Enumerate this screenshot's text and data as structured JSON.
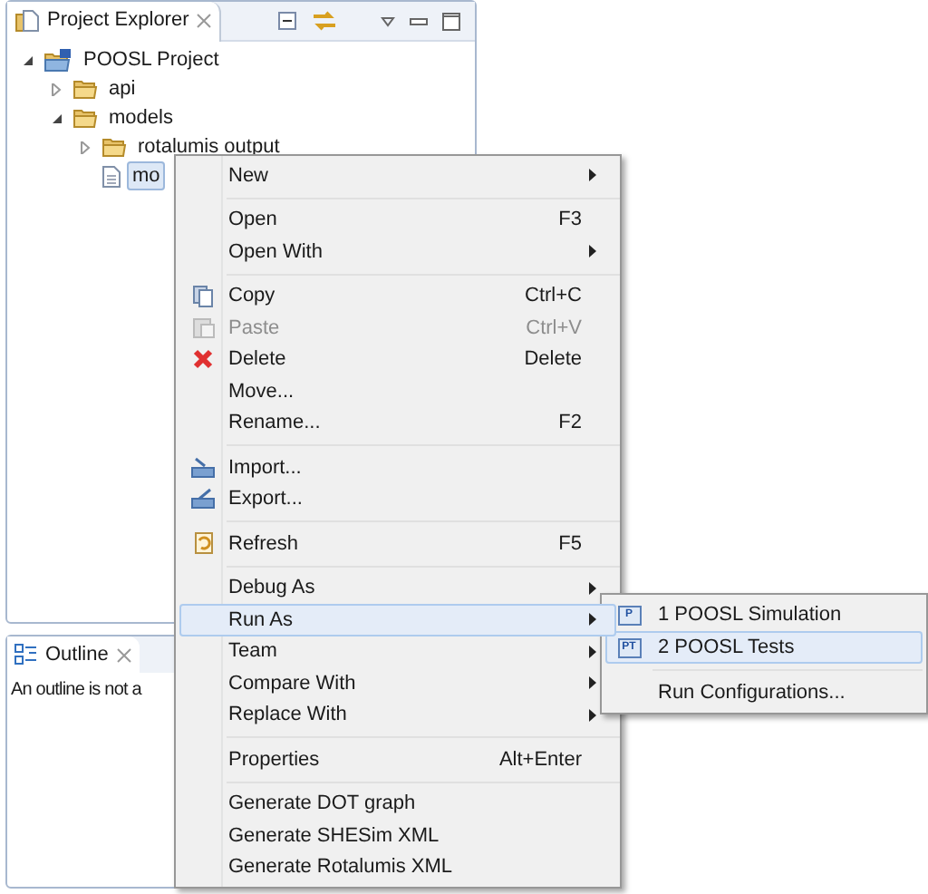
{
  "project_explorer": {
    "title": "Project Explorer",
    "tree": [
      {
        "label": "POOSL Project",
        "kind": "project",
        "expanded": true,
        "selected": false,
        "children": [
          {
            "label": "api",
            "kind": "folder",
            "expanded": false,
            "selected": false
          },
          {
            "label": "models",
            "kind": "folder",
            "expanded": true,
            "selected": false,
            "children": [
              {
                "label": "rotalumis output",
                "kind": "folder",
                "expanded": false,
                "selected": false
              },
              {
                "label": "mo",
                "kind": "file",
                "selected": true
              }
            ]
          }
        ]
      }
    ]
  },
  "outline": {
    "title": "Outline",
    "message": "An outline is not a"
  },
  "context_menu": {
    "items": [
      {
        "kind": "plain",
        "label": "New",
        "submenu": true,
        "selected": false,
        "disabled": false
      },
      {
        "kind": "separator"
      },
      {
        "kind": "plain",
        "label": "Open",
        "shortcut": "F3",
        "selected": false,
        "disabled": false
      },
      {
        "kind": "plain",
        "label": "Open With",
        "submenu": true,
        "selected": false,
        "disabled": false
      },
      {
        "kind": "separator"
      },
      {
        "kind": "copy",
        "label": "Copy",
        "shortcut": "Ctrl+C",
        "selected": false,
        "disabled": false
      },
      {
        "kind": "paste",
        "label": "Paste",
        "shortcut": "Ctrl+V",
        "selected": false,
        "disabled": true
      },
      {
        "kind": "delete",
        "label": "Delete",
        "shortcut": "Delete",
        "selected": false,
        "disabled": false
      },
      {
        "kind": "plain",
        "label": "Move...",
        "selected": false,
        "disabled": false
      },
      {
        "kind": "plain",
        "label": "Rename...",
        "shortcut": "F2",
        "selected": false,
        "disabled": false
      },
      {
        "kind": "separator"
      },
      {
        "kind": "import",
        "label": "Import...",
        "selected": false,
        "disabled": false
      },
      {
        "kind": "export",
        "label": "Export...",
        "selected": false,
        "disabled": false
      },
      {
        "kind": "separator"
      },
      {
        "kind": "refresh",
        "label": "Refresh",
        "shortcut": "F5",
        "selected": false,
        "disabled": false
      },
      {
        "kind": "separator"
      },
      {
        "kind": "plain",
        "label": "Debug As",
        "submenu": true,
        "selected": false,
        "disabled": false
      },
      {
        "kind": "plain",
        "label": "Run As",
        "submenu": true,
        "selected": true,
        "disabled": false
      },
      {
        "kind": "plain",
        "label": "Team",
        "submenu": true,
        "selected": false,
        "disabled": false
      },
      {
        "kind": "plain",
        "label": "Compare With",
        "submenu": true,
        "selected": false,
        "disabled": false
      },
      {
        "kind": "plain",
        "label": "Replace With",
        "submenu": true,
        "selected": false,
        "disabled": false
      },
      {
        "kind": "separator"
      },
      {
        "kind": "plain",
        "label": "Properties",
        "shortcut": "Alt+Enter",
        "selected": false,
        "disabled": false
      },
      {
        "kind": "separator"
      },
      {
        "kind": "plain",
        "label": "Generate DOT graph",
        "selected": false,
        "disabled": false
      },
      {
        "kind": "plain",
        "label": "Generate SHESim XML",
        "selected": false,
        "disabled": false
      },
      {
        "kind": "plain",
        "label": "Generate Rotalumis XML",
        "selected": false,
        "disabled": false
      }
    ]
  },
  "run_as_submenu": {
    "items": [
      {
        "kind": "launch",
        "label": "1 POOSL Simulation",
        "badge": "P",
        "selected": false
      },
      {
        "kind": "launch",
        "label": "2 POOSL Tests",
        "badge": "PT",
        "selected": true
      },
      {
        "kind": "separator"
      },
      {
        "kind": "plain",
        "label": "Run Configurations...",
        "selected": false
      }
    ]
  }
}
